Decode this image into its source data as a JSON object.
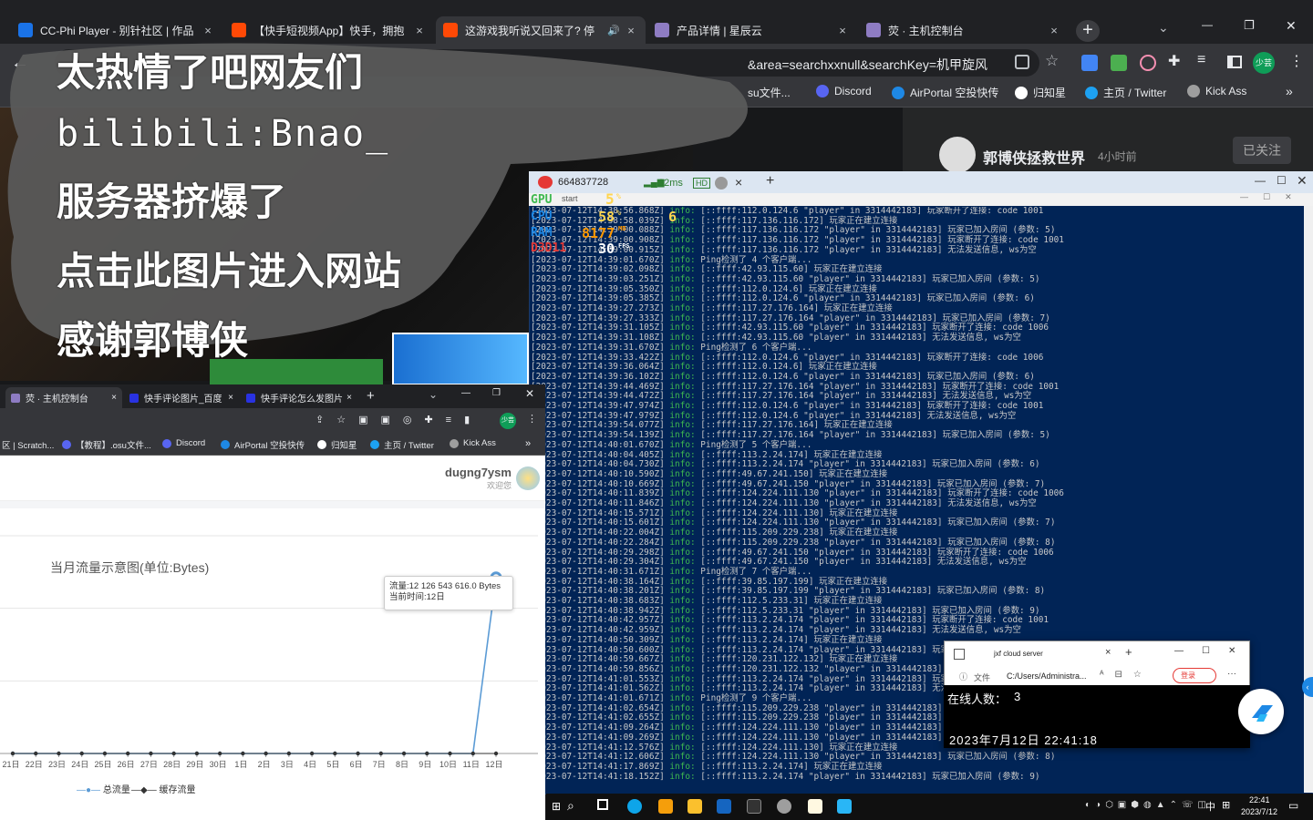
{
  "tabs": [
    {
      "title": "CC-Phi Player - 别针社区 | 作品",
      "close": "×",
      "color": "#1a73e8"
    },
    {
      "title": "【快手短视频App】快手，拥抱",
      "close": "×",
      "color": "#ff4906"
    },
    {
      "title": "这游戏我听说又回来了? 停",
      "close": "×",
      "color": "#ff4906",
      "audio": "🔊"
    },
    {
      "title": "产品详情 | 星辰云",
      "close": "×",
      "color": "#8e7cc3"
    },
    {
      "title": "荧 · 主机控制台",
      "close": "×",
      "color": "#8e7cc3"
    }
  ],
  "new_tab": "+",
  "window_controls": {
    "dropdown": "⌄",
    "minimize": "—",
    "restore": "❐",
    "close": "✕"
  },
  "omnibox": {
    "url_fragment": "&area=searchxxnull&searchKey=机甲旋风",
    "profile": "少芸"
  },
  "bookmarks": [
    {
      "label": "su文件...",
      "color": "#e74c3c"
    },
    {
      "label": "Discord",
      "color": "#5865f2"
    },
    {
      "label": "AirPortal 空投快传",
      "color": "#1e88e5"
    },
    {
      "label": "归知星",
      "color": "#ffffff"
    },
    {
      "label": "主页 / Twitter",
      "color": "#1da1f2"
    },
    {
      "label": "Kick Ass",
      "color": "#9e9e9e"
    }
  ],
  "bookmarks_more": "»",
  "channel": {
    "name": "郭博侠拯救世界",
    "time": "4小时前",
    "follow": "已关注"
  },
  "overlay_lines": [
    "太热情了吧网友们",
    "bilibili:Bnao_",
    "服务器挤爆了",
    "点击此图片进入网站",
    "感谢郭博侠"
  ],
  "term_tab": {
    "title": "664837728",
    "ping": "32ms",
    "hd": "HD",
    "close": "×",
    "add": "+"
  },
  "term_sub": "start",
  "hud": {
    "gpu_label": "GPU",
    "gpu_val": "5",
    "gpu_unit": "%",
    "cpu_label": "CPU",
    "cpu_val": "58",
    "cpu_unit": "%",
    "cpu_temp": "6",
    "ram_label": "RAM",
    "ram_val": "8177",
    "ram_unit": "MB",
    "d3d_label": "D3D11",
    "fps_val": "30",
    "fps_unit": "FPS"
  },
  "log_lines": [
    {
      "ts": "[2023-07-12T14:38:56.868Z]",
      "lv": "info:",
      "msg": "[::ffff:112.0.124.6 \"player\" in 3314442183] 玩家断开了连接: code 1001"
    },
    {
      "ts": "[2023-07-12T14:38:58.039Z]",
      "lv": "info:",
      "msg": "[::ffff:117.136.116.172] 玩家正在建立连接"
    },
    {
      "ts": "[2023-07-12T14:39:00.088Z]",
      "lv": "info:",
      "msg": "[::ffff:117.136.116.172 \"player\" in 3314442183] 玩家已加入房间 (参数: 5)"
    },
    {
      "ts": "[2023-07-12T14:39:00.908Z]",
      "lv": "info:",
      "msg": "[::ffff:117.136.116.172 \"player\" in 3314442183] 玩家断开了连接: code 1001"
    },
    {
      "ts": "[2023-07-12T14:39:00.915Z]",
      "lv": "info:",
      "msg": "[::ffff:117.136.116.172 \"player\" in 3314442183] 无法发送信息, ws为空"
    },
    {
      "ts": "[2023-07-12T14:39:01.670Z]",
      "lv": "info:",
      "msg": "Ping检测了 4 个客户端..."
    },
    {
      "ts": "[2023-07-12T14:39:02.098Z]",
      "lv": "info:",
      "msg": "[::ffff:42.93.115.60] 玩家正在建立连接"
    },
    {
      "ts": "[2023-07-12T14:39:03.251Z]",
      "lv": "info:",
      "msg": "[::ffff:42.93.115.60 \"player\" in 3314442183] 玩家已加入房间 (参数: 5)"
    },
    {
      "ts": "[2023-07-12T14:39:05.350Z]",
      "lv": "info:",
      "msg": "[::ffff:112.0.124.6] 玩家正在建立连接"
    },
    {
      "ts": "[2023-07-12T14:39:05.385Z]",
      "lv": "info:",
      "msg": "[::ffff:112.0.124.6 \"player\" in 3314442183] 玩家已加入房间 (参数: 6)"
    },
    {
      "ts": "[2023-07-12T14:39:27.273Z]",
      "lv": "info:",
      "msg": "[::ffff:117.27.176.164] 玩家正在建立连接"
    },
    {
      "ts": "[2023-07-12T14:39:27.333Z]",
      "lv": "info:",
      "msg": "[::ffff:117.27.176.164 \"player\" in 3314442183] 玩家已加入房间 (参数: 7)"
    },
    {
      "ts": "[2023-07-12T14:39:31.105Z]",
      "lv": "info:",
      "msg": "[::ffff:42.93.115.60 \"player\" in 3314442183] 玩家断开了连接: code 1006"
    },
    {
      "ts": "[2023-07-12T14:39:31.108Z]",
      "lv": "info:",
      "msg": "[::ffff:42.93.115.60 \"player\" in 3314442183] 无法发送信息, ws为空"
    },
    {
      "ts": "[2023-07-12T14:39:31.670Z]",
      "lv": "info:",
      "msg": "Ping检测了 6 个客户端..."
    },
    {
      "ts": "[2023-07-12T14:39:33.422Z]",
      "lv": "info:",
      "msg": "[::ffff:112.0.124.6 \"player\" in 3314442183] 玩家断开了连接: code 1006"
    },
    {
      "ts": "[2023-07-12T14:39:36.064Z]",
      "lv": "info:",
      "msg": "[::ffff:112.0.124.6] 玩家正在建立连接"
    },
    {
      "ts": "[2023-07-12T14:39:36.102Z]",
      "lv": "info:",
      "msg": "[::ffff:112.0.124.6 \"player\" in 3314442183] 玩家已加入房间 (参数: 6)"
    },
    {
      "ts": "[2023-07-12T14:39:44.469Z]",
      "lv": "info:",
      "msg": "[::ffff:117.27.176.164 \"player\" in 3314442183] 玩家断开了连接: code 1001"
    },
    {
      "ts": "[2023-07-12T14:39:44.472Z]",
      "lv": "info:",
      "msg": "[::ffff:117.27.176.164 \"player\" in 3314442183] 无法发送信息, ws为空"
    },
    {
      "ts": "[2023-07-12T14:39:47.974Z]",
      "lv": "info:",
      "msg": "[::ffff:112.0.124.6 \"player\" in 3314442183] 玩家断开了连接: code 1001"
    },
    {
      "ts": "[2023-07-12T14:39:47.979Z]",
      "lv": "info:",
      "msg": "[::ffff:112.0.124.6 \"player\" in 3314442183] 无法发送信息, ws为空"
    },
    {
      "ts": "[2023-07-12T14:39:54.077Z]",
      "lv": "info:",
      "msg": "[::ffff:117.27.176.164] 玩家正在建立连接"
    },
    {
      "ts": "[2023-07-12T14:39:54.139Z]",
      "lv": "info:",
      "msg": "[::ffff:117.27.176.164 \"player\" in 3314442183] 玩家已加入房间 (参数: 5)"
    },
    {
      "ts": "[2023-07-12T14:40:01.670Z]",
      "lv": "info:",
      "msg": "Ping检测了 5 个客户端..."
    },
    {
      "ts": "[2023-07-12T14:40:04.405Z]",
      "lv": "info:",
      "msg": "[::ffff:113.2.24.174] 玩家正在建立连接"
    },
    {
      "ts": "[2023-07-12T14:40:04.730Z]",
      "lv": "info:",
      "msg": "[::ffff:113.2.24.174 \"player\" in 3314442183] 玩家已加入房间 (参数: 6)"
    },
    {
      "ts": "[2023-07-12T14:40:10.590Z]",
      "lv": "info:",
      "msg": "[::ffff:49.67.241.150] 玩家正在建立连接"
    },
    {
      "ts": "[2023-07-12T14:40:10.669Z]",
      "lv": "info:",
      "msg": "[::ffff:49.67.241.150 \"player\" in 3314442183] 玩家已加入房间 (参数: 7)"
    },
    {
      "ts": "[2023-07-12T14:40:11.839Z]",
      "lv": "info:",
      "msg": "[::ffff:124.224.111.130 \"player\" in 3314442183] 玩家断开了连接: code 1006"
    },
    {
      "ts": "[2023-07-12T14:40:11.846Z]",
      "lv": "info:",
      "msg": "[::ffff:124.224.111.130 \"player\" in 3314442183] 无法发送信息, ws为空"
    },
    {
      "ts": "[2023-07-12T14:40:15.571Z]",
      "lv": "info:",
      "msg": "[::ffff:124.224.111.130] 玩家正在建立连接"
    },
    {
      "ts": "[2023-07-12T14:40:15.601Z]",
      "lv": "info:",
      "msg": "[::ffff:124.224.111.130 \"player\" in 3314442183] 玩家已加入房间 (参数: 7)"
    },
    {
      "ts": "[2023-07-12T14:40:22.004Z]",
      "lv": "info:",
      "msg": "[::ffff:115.209.229.238] 玩家正在建立连接"
    },
    {
      "ts": "[2023-07-12T14:40:22.284Z]",
      "lv": "info:",
      "msg": "[::ffff:115.209.229.238 \"player\" in 3314442183] 玩家已加入房间 (参数: 8)"
    },
    {
      "ts": "[2023-07-12T14:40:29.298Z]",
      "lv": "info:",
      "msg": "[::ffff:49.67.241.150 \"player\" in 3314442183] 玩家断开了连接: code 1006"
    },
    {
      "ts": "[2023-07-12T14:40:29.304Z]",
      "lv": "info:",
      "msg": "[::ffff:49.67.241.150 \"player\" in 3314442183] 无法发送信息, ws为空"
    },
    {
      "ts": "[2023-07-12T14:40:31.671Z]",
      "lv": "info:",
      "msg": "Ping检测了 7 个客户端..."
    },
    {
      "ts": "[2023-07-12T14:40:38.164Z]",
      "lv": "info:",
      "msg": "[::ffff:39.85.197.199] 玩家正在建立连接"
    },
    {
      "ts": "[2023-07-12T14:40:38.201Z]",
      "lv": "info:",
      "msg": "[::ffff:39.85.197.199 \"player\" in 3314442183] 玩家已加入房间 (参数: 8)"
    },
    {
      "ts": "[2023-07-12T14:40:38.683Z]",
      "lv": "info:",
      "msg": "[::ffff:112.5.233.31] 玩家正在建立连接"
    },
    {
      "ts": "[2023-07-12T14:40:38.942Z]",
      "lv": "info:",
      "msg": "[::ffff:112.5.233.31 \"player\" in 3314442183] 玩家已加入房间 (参数: 9)"
    },
    {
      "ts": "[2023-07-12T14:40:42.957Z]",
      "lv": "info:",
      "msg": "[::ffff:113.2.24.174 \"player\" in 3314442183] 玩家断开了连接: code 1001"
    },
    {
      "ts": "[2023-07-12T14:40:42.959Z]",
      "lv": "info:",
      "msg": "[::ffff:113.2.24.174 \"player\" in 3314442183] 无法发送信息, ws为空"
    },
    {
      "ts": "[2023-07-12T14:40:50.309Z]",
      "lv": "info:",
      "msg": "[::ffff:113.2.24.174] 玩家正在建立连接"
    },
    {
      "ts": "[2023-07-12T14:40:50.600Z]",
      "lv": "info:",
      "msg": "[::ffff:113.2.24.174 \"player\" in 3314442183] 玩家已加入房间 (参数: 9)"
    },
    {
      "ts": "[2023-07-12T14:40:59.667Z]",
      "lv": "info:",
      "msg": "[::ffff:120.231.122.132] 玩家正在建立连接"
    },
    {
      "ts": "[2023-07-12T14:40:59.856Z]",
      "lv": "info:",
      "msg": "[::ffff:120.231.122.132 \"player\" in 3314442183] 玩家已加入房间 (参数: 9)"
    },
    {
      "ts": "[2023-07-12T14:41:01.553Z]",
      "lv": "info:",
      "msg": "[::ffff:113.2.24.174 \"player\" in 3314442183] 玩家断开了连接: code 1001"
    },
    {
      "ts": "[2023-07-12T14:41:01.562Z]",
      "lv": "info:",
      "msg": "[::ffff:113.2.24.174 \"player\" in 3314442183] 无法发送信息, ws为空"
    },
    {
      "ts": "[2023-07-12T14:41:01.671Z]",
      "lv": "info:",
      "msg": "Ping检测了 9 个客户端..."
    },
    {
      "ts": "[2023-07-12T14:41:02.654Z]",
      "lv": "info:",
      "msg": "[::ffff:115.209.229.238 \"player\" in 3314442183] 玩家断开了连接: code 1006"
    },
    {
      "ts": "[2023-07-12T14:41:02.655Z]",
      "lv": "info:",
      "msg": "[::ffff:115.209.229.238 \"player\" in 3314442183] 无法发送信息, ws为空"
    },
    {
      "ts": "[2023-07-12T14:41:09.264Z]",
      "lv": "info:",
      "msg": "[::ffff:124.224.111.130 \"player\" in 3314442183] 玩家断开了连接: code 1006"
    },
    {
      "ts": "[2023-07-12T14:41:09.269Z]",
      "lv": "info:",
      "msg": "[::ffff:124.224.111.130 \"player\" in 3314442183] 无法发送信息, ws为空"
    },
    {
      "ts": "[2023-07-12T14:41:12.576Z]",
      "lv": "info:",
      "msg": "[::ffff:124.224.111.130] 玩家正在建立连接"
    },
    {
      "ts": "[2023-07-12T14:41:12.606Z]",
      "lv": "info:",
      "msg": "[::ffff:124.224.111.130 \"player\" in 3314442183] 玩家已加入房间 (参数: 8)"
    },
    {
      "ts": "[2023-07-12T14:41:17.869Z]",
      "lv": "info:",
      "msg": "[::ffff:113.2.24.174] 玩家正在建立连接"
    },
    {
      "ts": "[2023-07-12T14:41:18.152Z]",
      "lv": "info:",
      "msg": "[::ffff:113.2.24.174 \"player\" in 3314442183] 玩家已加入房间 (参数: 9)"
    }
  ],
  "win2": {
    "tabs": [
      {
        "title": "荧 · 主机控制台",
        "close": "×",
        "color": "#8e7cc3"
      },
      {
        "title": "快手评论图片_百度",
        "close": "×",
        "color": "#2932e1"
      },
      {
        "title": "快手评论怎么发图片",
        "close": "×",
        "color": "#2932e1"
      }
    ],
    "new_tab": "+",
    "bookmarks": [
      {
        "label": "区 | Scratch...",
        "color": "#f39c12"
      },
      {
        "label": "【教程】.osu文件...",
        "color": "#5865f2"
      },
      {
        "label": "Discord",
        "color": "#5865f2"
      },
      {
        "label": "AirPortal 空投快传",
        "color": "#1e88e5"
      },
      {
        "label": "归知星",
        "color": "#ffffff"
      },
      {
        "label": "主页 / Twitter",
        "color": "#1da1f2"
      },
      {
        "label": "Kick Ass",
        "color": "#9e9e9e"
      }
    ],
    "more": "»",
    "user": {
      "name": "dugng7ysm",
      "sub": "欢迎您"
    }
  },
  "chart_data": {
    "type": "line",
    "title": "当月流量示意图(单位:Bytes)",
    "categories": [
      "21日",
      "22日",
      "23日",
      "24日",
      "25日",
      "26日",
      "27日",
      "28日",
      "29日",
      "30日",
      "1日",
      "2日",
      "3日",
      "4日",
      "5日",
      "6日",
      "7日",
      "8日",
      "9日",
      "10日",
      "11日",
      "12日"
    ],
    "series": [
      {
        "name": "总流量",
        "values": [
          0,
          0,
          0,
          0,
          0,
          0,
          0,
          0,
          0,
          0,
          0,
          0,
          0,
          0,
          0,
          0,
          0,
          0,
          0,
          0,
          0,
          12126543616.0
        ],
        "color": "#5b9bd5"
      },
      {
        "name": "缓存流量",
        "values": [
          0,
          0,
          0,
          0,
          0,
          0,
          0,
          0,
          0,
          0,
          0,
          0,
          0,
          0,
          0,
          0,
          0,
          0,
          0,
          0,
          0,
          0
        ],
        "color": "#333333"
      }
    ],
    "tooltip": {
      "line1": "流量:12 126 543 616.0 Bytes",
      "line2": "当前时间:12日"
    },
    "ylim": [
      0,
      15000000000
    ],
    "grid": true,
    "legend": "bottom"
  },
  "edge": {
    "tab_title": "jxf cloud server",
    "close": "×",
    "add": "+",
    "file_label": "文件",
    "path": "C:/Users/Administra...",
    "login": "登录",
    "online_label": "在线人数：",
    "online_count": "3",
    "datetime": "2023年7月12日 22:41:18"
  },
  "taskbar": {
    "time": "22:41",
    "date": "2023/7/12",
    "ime": "中"
  }
}
